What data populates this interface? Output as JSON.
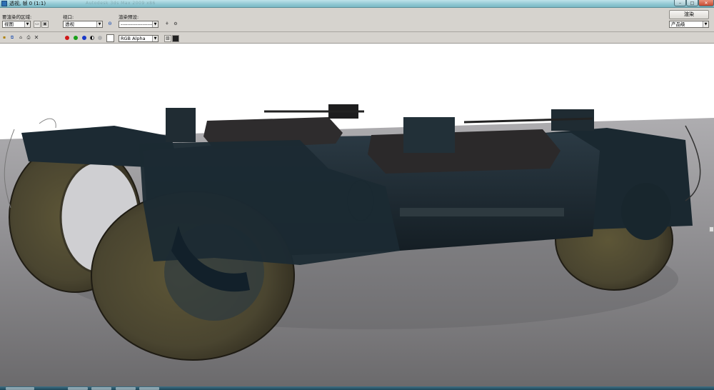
{
  "window": {
    "title": "透视, 帧 0 (1:1)",
    "ghost_title": "Autodesk 3ds Max 2009 x86"
  },
  "toolbar": {
    "area_label": "要渲染的区域:",
    "area_value": "视图",
    "viewport_label": "视口:",
    "viewport_value": "透视",
    "preset_label": "渲染预设:",
    "preset_value": "-------------------",
    "render_button": "渲染",
    "product_value": "产品级",
    "channel_value": "RGB Alpha"
  },
  "colors": {
    "red_channel": "#d01818",
    "green_channel": "#18a018",
    "blue_channel": "#1838c8",
    "titlebar": "#8fc7d2",
    "toolbar_bg": "#d6d3ce"
  },
  "icons": {
    "save": "save-icon",
    "copy": "copy-icon",
    "clone": "clone-window-icon",
    "print": "print-icon",
    "clear": "close-icon",
    "lock": "lock-icon",
    "edit_region": "edit-region-icon",
    "auto_region": "auto-region-icon",
    "env_settings": "environment-icon",
    "render_setup": "render-setup-icon"
  }
}
